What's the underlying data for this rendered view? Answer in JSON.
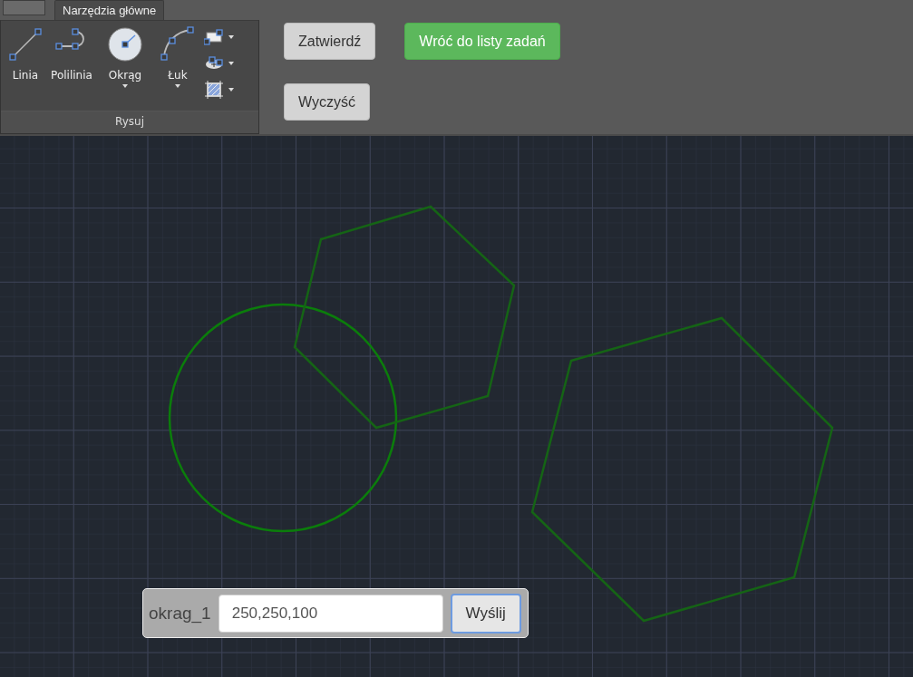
{
  "ribbon": {
    "tabs": [
      {
        "label": "Narzędzia główne",
        "selected": true
      }
    ],
    "panel": {
      "title": "Rysuj",
      "tools": [
        {
          "label": "Linia",
          "kind": "line",
          "dropdown": false
        },
        {
          "label": "Polilinia",
          "kind": "polyline",
          "dropdown": false
        },
        {
          "label": "Okrąg",
          "kind": "circle",
          "dropdown": true
        },
        {
          "label": "Łuk",
          "kind": "arc",
          "dropdown": true
        }
      ],
      "small_tools": [
        {
          "kind": "rectangle",
          "dropdown": true
        },
        {
          "kind": "ellipse",
          "dropdown": true
        },
        {
          "kind": "hatch",
          "dropdown": true
        }
      ]
    }
  },
  "button_rows": [
    [
      {
        "label": "Zatwierdź",
        "kind": "default"
      },
      {
        "label": "Wróć do listy zadań",
        "kind": "primary"
      }
    ],
    [
      {
        "label": "Wyczyść",
        "kind": "default"
      }
    ]
  ],
  "command": {
    "label": "okrag_1",
    "value": "250,250,100",
    "button": "Wyślij"
  }
}
